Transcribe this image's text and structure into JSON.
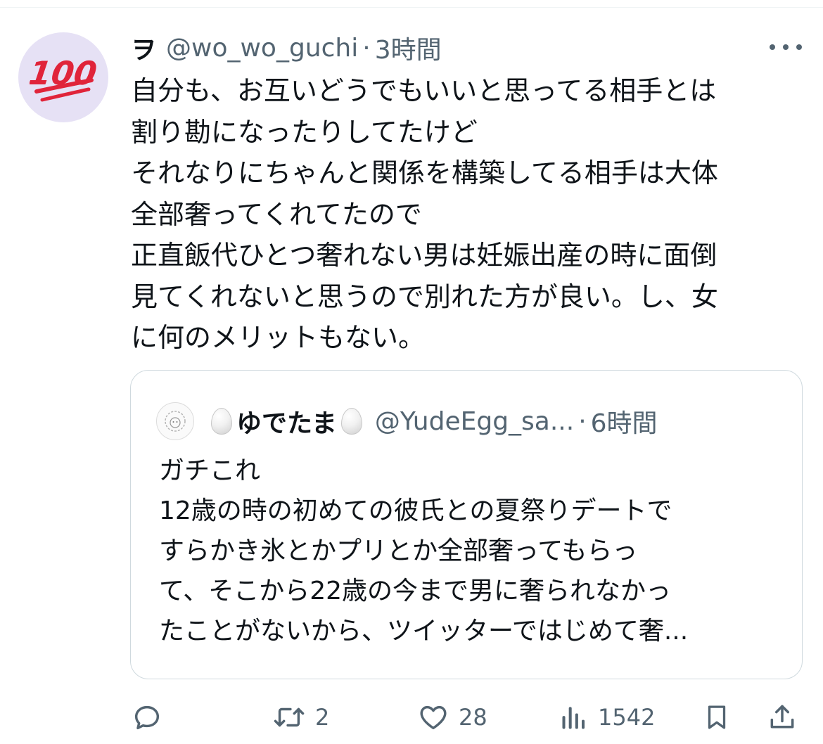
{
  "tweet": {
    "name": "ヲ",
    "handle": "@wo_wo_guchi",
    "separator": "·",
    "time": "3時間",
    "avatar_icon": "hundred-points-emoji",
    "body_lines": [
      "自分も、お互いどうでもいいと思ってる相手とは",
      "割り勘になったりしてたけど",
      "それなりにちゃんと関係を構築してる相手は大体",
      "全部奢ってくれてたので",
      "正直飯代ひとつ奢れない男は妊娠出産の時に面倒",
      "見てくれないと思うので別れた方が良い。し、女",
      "に何のメリットもない。"
    ]
  },
  "quote": {
    "name": "ゆでたま",
    "handle": "@YudeEgg_sa...",
    "separator": "·",
    "time": "6時間",
    "name_icons": [
      "egg-icon",
      "egg-icon"
    ],
    "body_lines": [
      "ガチこれ",
      "12歳の時の初めての彼氏との夏祭りデートで",
      "すらかき氷とかプリとか全部奢ってもらっ",
      "て、そこから22歳の今まで男に奢られなかっ",
      "たことがないから、ツイッターではじめて奢..."
    ]
  },
  "actions": {
    "reply_count": "",
    "retweet_count": "2",
    "like_count": "28",
    "views_count": "1542"
  },
  "colors": {
    "text": "#0f1419",
    "secondary": "#536471",
    "border": "#cfd9de",
    "hundred_red": "#e0243a",
    "avatar_bg": "#e6e1f5"
  }
}
